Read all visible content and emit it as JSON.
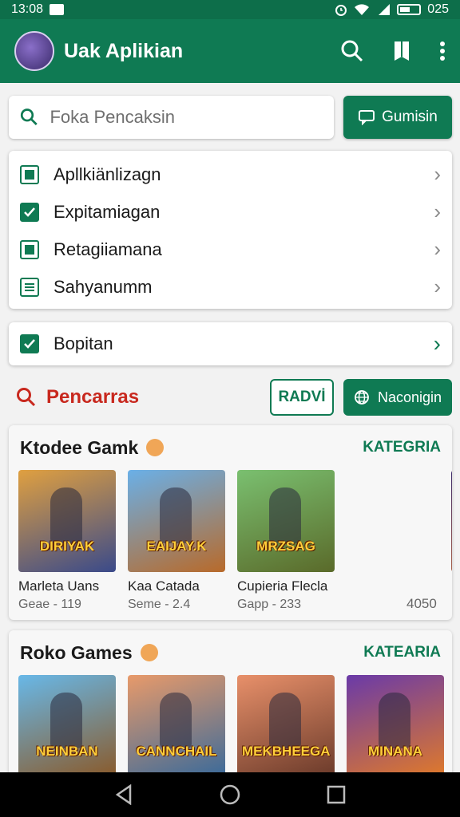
{
  "status": {
    "time": "13:08",
    "battery": "025"
  },
  "app_bar": {
    "title": "Uak Aplikian",
    "icons": [
      "search-icon",
      "bookmark-icon",
      "more-vert-icon"
    ]
  },
  "search": {
    "placeholder": "Foka Pencaksin",
    "button_label": "Gumisin"
  },
  "menu": {
    "items": [
      {
        "label": "Apllkiänlizagn",
        "icon": "square-check-icon"
      },
      {
        "label": "Expitamiagan",
        "icon": "checkbox-checked-icon"
      },
      {
        "label": "Retagiiamana",
        "icon": "square-check-icon"
      },
      {
        "label": "Sahyanumm",
        "icon": "document-icon"
      }
    ]
  },
  "single": {
    "label": "Bopitan"
  },
  "filter": {
    "title": "Pencarras",
    "outline_label": "RADVİ",
    "button_label": "Naconigin"
  },
  "section1": {
    "title": "Ktodee Gamk",
    "link": "KATEGRIA",
    "games": [
      {
        "name": "Marleta Uans",
        "meta": "Geae - 119",
        "logo": "DIRIYAK",
        "c1": "#e0a040",
        "c2": "#3a4a8a"
      },
      {
        "name": "Kaa Catada",
        "meta": "Seme - 2.4",
        "logo": "EAIJAY.K",
        "c1": "#6ab0e8",
        "c2": "#b86a2a"
      },
      {
        "name": "Cupieria Flecla",
        "meta": "Gapp - 233",
        "logo": "MRZSAG",
        "c1": "#7ac070",
        "c2": "#5a6a2a"
      }
    ],
    "extra_count": "4050"
  },
  "section2": {
    "title": "Roko Games",
    "link": "KATEARIA",
    "games": [
      {
        "logo": "NEINBAN",
        "c1": "#68b8e8",
        "c2": "#8a5a2a"
      },
      {
        "logo": "CANNCHAIL",
        "c1": "#e89a6a",
        "c2": "#3a6a9a"
      },
      {
        "logo": "MEKBHEEGA",
        "c1": "#e8906a",
        "c2": "#6a3a2a"
      },
      {
        "logo": "MINANA",
        "c1": "#6a3aa8",
        "c2": "#e07a2a"
      }
    ]
  },
  "colors": {
    "primary": "#0f7a53",
    "accent_red": "#c8281e"
  }
}
